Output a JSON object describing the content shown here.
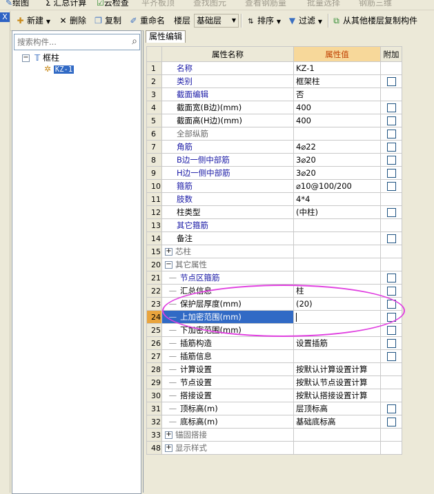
{
  "top_toolbar": {
    "items": [
      "绘图",
      "Σ 汇总计算",
      "云检查",
      "平齐板顶",
      "查找图元",
      "查看钢筋量",
      "批量选择",
      "钢筋三维"
    ]
  },
  "toolbar": {
    "new_label": "新建",
    "delete_label": "删除",
    "copy_label": "复制",
    "rename_label": "重命名",
    "floor_label": "楼层",
    "floor_value": "基础层",
    "sort_label": "排序",
    "filter_label": "过滤",
    "copy_from_floor_label": "从其他楼层复制构件"
  },
  "left_close": "X",
  "search": {
    "placeholder": "搜索构件..."
  },
  "tree": {
    "root_label": "框柱",
    "root_expander": "−",
    "child_label": "KZ-1"
  },
  "tab": {
    "label": "属性编辑"
  },
  "grid": {
    "headers": {
      "name": "属性名称",
      "value": "属性值",
      "extra": "附加"
    },
    "rows": [
      {
        "num": "1",
        "name": "名称",
        "value": "KZ-1",
        "color": "blue",
        "check": false,
        "indent": 0
      },
      {
        "num": "2",
        "name": "类别",
        "value": "框架柱",
        "color": "blue",
        "check": true,
        "indent": 0
      },
      {
        "num": "3",
        "name": "截面编辑",
        "value": "否",
        "color": "blue",
        "check": false,
        "indent": 0
      },
      {
        "num": "4",
        "name": "截面宽(B边)(mm)",
        "value": "400",
        "color": "black",
        "check": true,
        "indent": 0
      },
      {
        "num": "5",
        "name": "截面高(H边)(mm)",
        "value": "400",
        "color": "black",
        "check": true,
        "indent": 0
      },
      {
        "num": "6",
        "name": "全部纵筋",
        "value": "",
        "color": "gray",
        "check": true,
        "indent": 0
      },
      {
        "num": "7",
        "name": "角筋",
        "value": "4⌀22",
        "color": "blue",
        "check": true,
        "indent": 0
      },
      {
        "num": "8",
        "name": "B边一侧中部筋",
        "value": "3⌀20",
        "color": "blue",
        "check": true,
        "indent": 0
      },
      {
        "num": "9",
        "name": "H边一侧中部筋",
        "value": "3⌀20",
        "color": "blue",
        "check": true,
        "indent": 0
      },
      {
        "num": "10",
        "name": "箍筋",
        "value": "⌀10@100/200",
        "color": "blue",
        "check": true,
        "indent": 0
      },
      {
        "num": "11",
        "name": "肢数",
        "value": "4*4",
        "color": "blue",
        "check": false,
        "indent": 0
      },
      {
        "num": "12",
        "name": "柱类型",
        "value": "(中柱)",
        "color": "black",
        "check": true,
        "indent": 0
      },
      {
        "num": "13",
        "name": "其它箍筋",
        "value": "",
        "color": "blue",
        "check": false,
        "indent": 0
      },
      {
        "num": "14",
        "name": "备注",
        "value": "",
        "color": "black",
        "check": true,
        "indent": 0
      },
      {
        "num": "15",
        "name": "芯柱",
        "value": "",
        "color": "gray",
        "check": false,
        "indent": 0,
        "expander": "+"
      },
      {
        "num": "20",
        "name": "其它属性",
        "value": "",
        "color": "gray",
        "check": false,
        "indent": 0,
        "expander": "−"
      },
      {
        "num": "21",
        "name": "节点区箍筋",
        "value": "",
        "color": "blue",
        "check": true,
        "indent": 1
      },
      {
        "num": "22",
        "name": "汇总信息",
        "value": "柱",
        "color": "black",
        "check": true,
        "indent": 1
      },
      {
        "num": "23",
        "name": "保护层厚度(mm)",
        "value": "(20)",
        "color": "black",
        "check": true,
        "indent": 1
      },
      {
        "num": "24",
        "name": "上加密范围(mm)",
        "value": "",
        "color": "black",
        "check": true,
        "indent": 1,
        "selected": true
      },
      {
        "num": "25",
        "name": "下加密范围(mm)",
        "value": "",
        "color": "black",
        "check": true,
        "indent": 1
      },
      {
        "num": "26",
        "name": "插筋构造",
        "value": "设置插筋",
        "color": "black",
        "check": true,
        "indent": 1
      },
      {
        "num": "27",
        "name": "插筋信息",
        "value": "",
        "color": "black",
        "check": true,
        "indent": 1
      },
      {
        "num": "28",
        "name": "计算设置",
        "value": "按默认计算设置计算",
        "color": "black",
        "check": false,
        "indent": 1
      },
      {
        "num": "29",
        "name": "节点设置",
        "value": "按默认节点设置计算",
        "color": "black",
        "check": false,
        "indent": 1
      },
      {
        "num": "30",
        "name": "搭接设置",
        "value": "按默认搭接设置计算",
        "color": "black",
        "check": false,
        "indent": 1
      },
      {
        "num": "31",
        "name": "顶标高(m)",
        "value": "层顶标高",
        "color": "black",
        "check": true,
        "indent": 1
      },
      {
        "num": "32",
        "name": "底标高(m)",
        "value": "基础底标高",
        "color": "black",
        "check": true,
        "indent": 1
      },
      {
        "num": "33",
        "name": "锚固搭接",
        "value": "",
        "color": "gray",
        "check": false,
        "indent": 0,
        "expander": "+"
      },
      {
        "num": "48",
        "name": "显示样式",
        "value": "",
        "color": "gray",
        "check": false,
        "indent": 0,
        "expander": "+"
      }
    ]
  },
  "colors": {
    "selection": "#316ac5",
    "header_value_bg": "#f7d89a",
    "annotation": "#e040e0"
  }
}
